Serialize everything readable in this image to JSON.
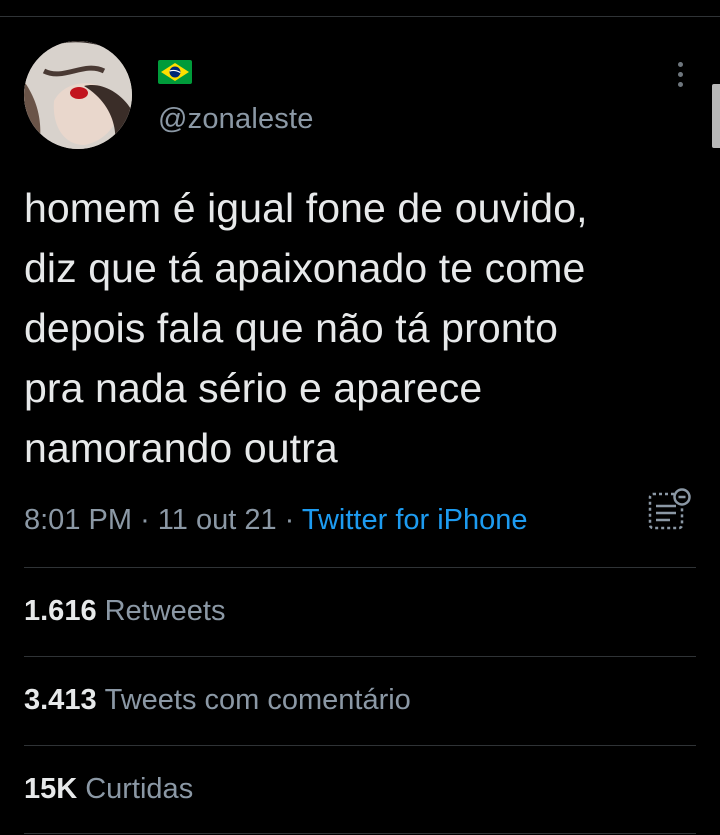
{
  "author": {
    "handle": "@zonaleste",
    "flag_icon": "brazil-flag-icon",
    "avatar_icon": "profile-photo"
  },
  "tweet": {
    "text": "homem é igual fone de ouvido,\ndiz que tá apaixonado te come\ndepois fala que não tá pronto\npra nada sério e aparece\nnamorando outra",
    "time": "8:01 PM",
    "separator": "·",
    "date": "11 out 21",
    "source": "Twitter for iPhone"
  },
  "stats": {
    "retweets": {
      "count": "1.616",
      "label": "Retweets"
    },
    "quotes": {
      "count": "3.413",
      "label": "Tweets com comentário"
    },
    "likes": {
      "count": "15K",
      "label": "Curtidas"
    }
  },
  "colors": {
    "background": "#000000",
    "text": "#e7e9ea",
    "secondary": "#8b98a5",
    "link": "#1d9bf0",
    "divider": "#2f3336"
  }
}
